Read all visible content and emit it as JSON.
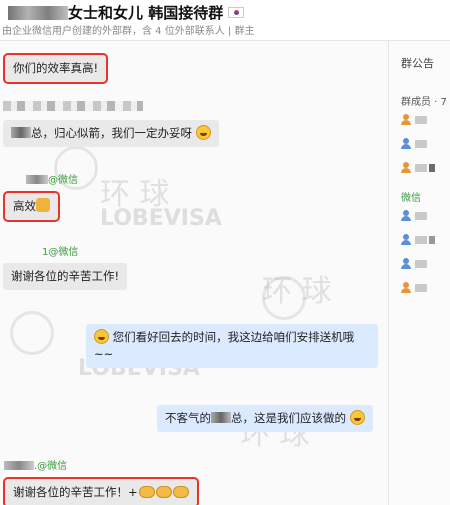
{
  "header": {
    "title": "女士和女儿 韩国接待群",
    "subtitle": "由企业微信用户创建的外部群，含 4 位外部联系人 | 群主"
  },
  "messages": [
    {
      "id": "m1",
      "direction": "in",
      "text": "你们的效率真高!",
      "highlighted": true
    },
    {
      "id": "m2",
      "direction": "in",
      "prefix": "总，归心似箭，我们一定办妥呀",
      "emoji": "grin-face"
    },
    {
      "id": "m3",
      "direction": "in",
      "sender_tag": "@微信",
      "text": "高效",
      "emoji": "thumbs-up",
      "highlighted": true
    },
    {
      "id": "m4",
      "direction": "in",
      "sender_tag": "1@微信",
      "text": "谢谢各位的辛苦工作!"
    },
    {
      "id": "m5",
      "direction": "out",
      "emoji": "grin-face",
      "text": "您们看好回去的时间，我这边给咱们安排送机哦",
      "text2": "~~"
    },
    {
      "id": "m6",
      "direction": "out",
      "text_a": "不客气的",
      "text_b": "总，这是我们应该做的",
      "emoji": "grin-face"
    },
    {
      "id": "m7",
      "direction": "in",
      "sender_tag": ".@微信",
      "text": "谢谢各位的辛苦工作！+",
      "emoji": "clap-hands",
      "highlighted": true
    }
  ],
  "sidebar": {
    "announcement_label": "群公告",
    "members_label": "群成员 · 7",
    "wechat_label": "微信"
  },
  "watermark": {
    "cn": "环 球",
    "en": "LOBEVISA"
  },
  "colors": {
    "highlight_border": "#e8332a",
    "incoming_bubble": "#e9e9e9",
    "outgoing_bubble": "#dbeaff",
    "wechat_tag": "#3a9b3a"
  }
}
